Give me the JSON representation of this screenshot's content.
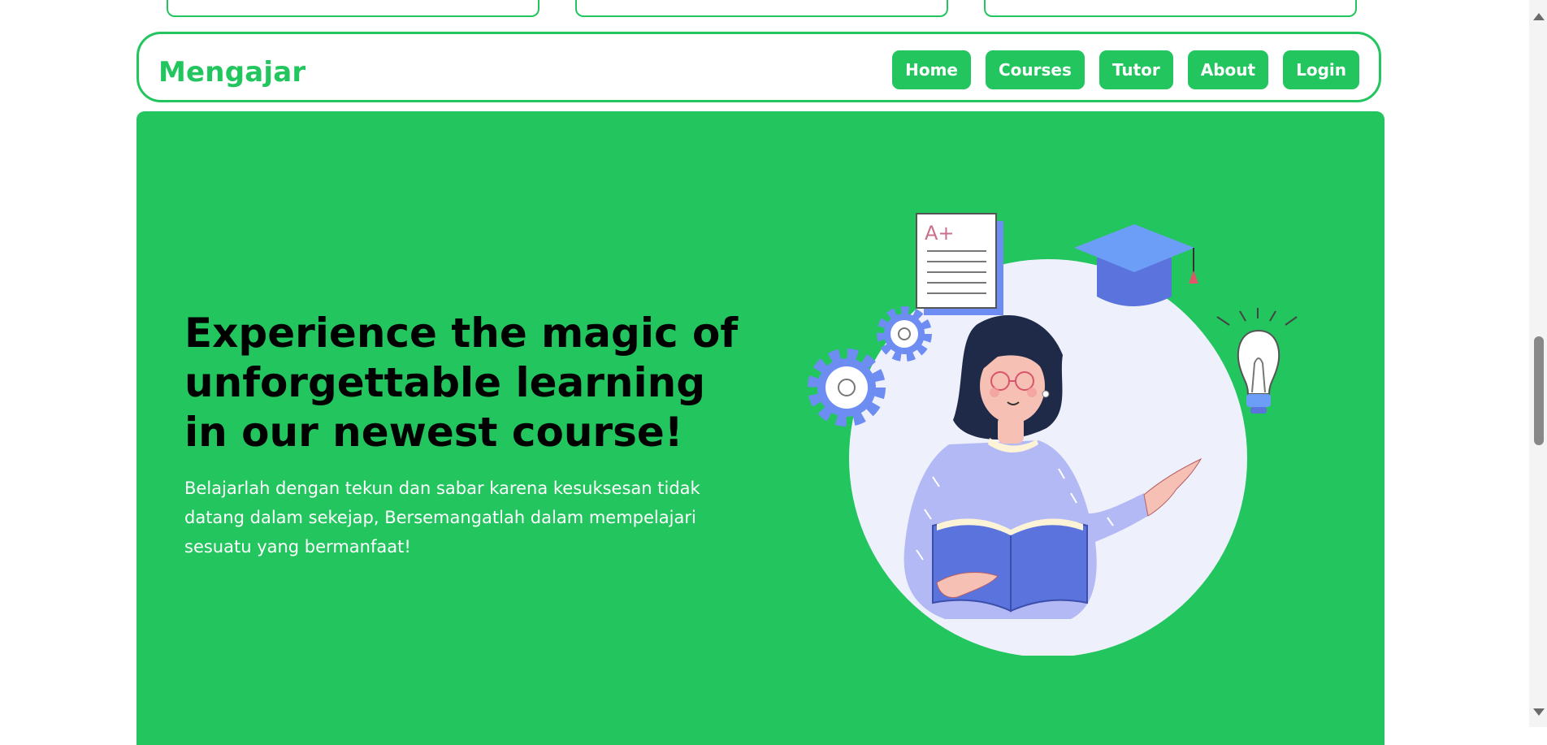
{
  "navbar": {
    "brand": "Mengajar",
    "links": [
      "Home",
      "Courses",
      "Tutor",
      "About",
      "Login"
    ]
  },
  "hero": {
    "title": "Experience the magic of unforgettable learning in our newest course!",
    "description": "Belajarlah dengan tekun dan sabar karena kesuksesan tidak datang dalam sekejap, Bersemangatlah dalam mempelajari sesuatu yang bermanfaat!",
    "illustration_label": "A+"
  },
  "colors": {
    "accent": "#22c55e",
    "hero_bg": "#22c55e",
    "text_dark": "#000000",
    "text_light": "#ffffff"
  }
}
